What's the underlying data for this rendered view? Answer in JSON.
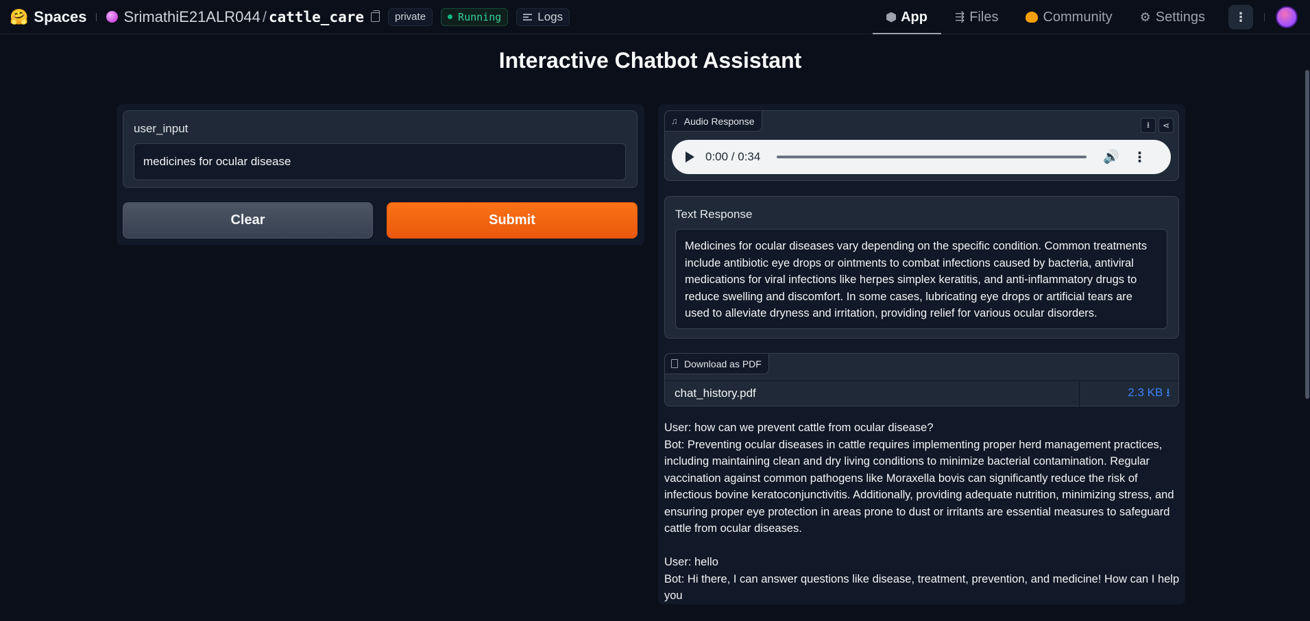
{
  "topbar": {
    "brand": "Spaces",
    "owner": "SrimathiE21ALR044",
    "repo": "cattle_care",
    "visibility": "private",
    "status": "Running",
    "logs": "Logs",
    "nav": [
      {
        "label": "App",
        "icon": "app-icon"
      },
      {
        "label": "Files",
        "icon": "files-icon"
      },
      {
        "label": "Community",
        "icon": "community-icon"
      },
      {
        "label": "Settings",
        "icon": "gear-icon"
      }
    ]
  },
  "page": {
    "title": "Interactive Chatbot Assistant"
  },
  "input": {
    "label": "user_input",
    "value": "medicines for ocular disease"
  },
  "buttons": {
    "clear": "Clear",
    "submit": "Submit"
  },
  "audio": {
    "label": "Audio Response",
    "time": "0:00 / 0:34",
    "progress": 0
  },
  "text_response": {
    "label": "Text Response",
    "value": "Medicines for ocular diseases vary depending on the specific condition. Common treatments include antibiotic eye drops or ointments to combat infections caused by bacteria, antiviral medications for viral infections like herpes simplex keratitis, and anti-inflammatory drugs to reduce swelling and discomfort. In some cases, lubricating eye drops or artificial tears are used to alleviate dryness and irritation, providing relief for various ocular disorders."
  },
  "pdf": {
    "label": "Download as PDF",
    "file_name": "chat_history.pdf",
    "file_size": "2.3 KB ⭳"
  },
  "history": {
    "q1": "User: how can we prevent cattle from ocular disease?",
    "a1": "Bot: Preventing ocular diseases in cattle requires implementing proper herd management practices, including maintaining clean and dry living conditions to minimize bacterial contamination. Regular vaccination against common pathogens like Moraxella bovis can significantly reduce the risk of infectious bovine keratoconjunctivitis. Additionally, providing adequate nutrition, minimizing stress, and ensuring proper eye protection in areas prone to dust or irritants are essential measures to safeguard cattle from ocular diseases.",
    "q2": "User: hello",
    "a2": "Bot: Hi there, I can answer questions like disease, treatment, prevention, and medicine! How can I help you"
  },
  "colors": {
    "background": "#0b0f19",
    "panel": "#111827",
    "block": "#1f2937",
    "accent": "#f97316",
    "running": "#10b981",
    "link": "#3b82f6"
  }
}
